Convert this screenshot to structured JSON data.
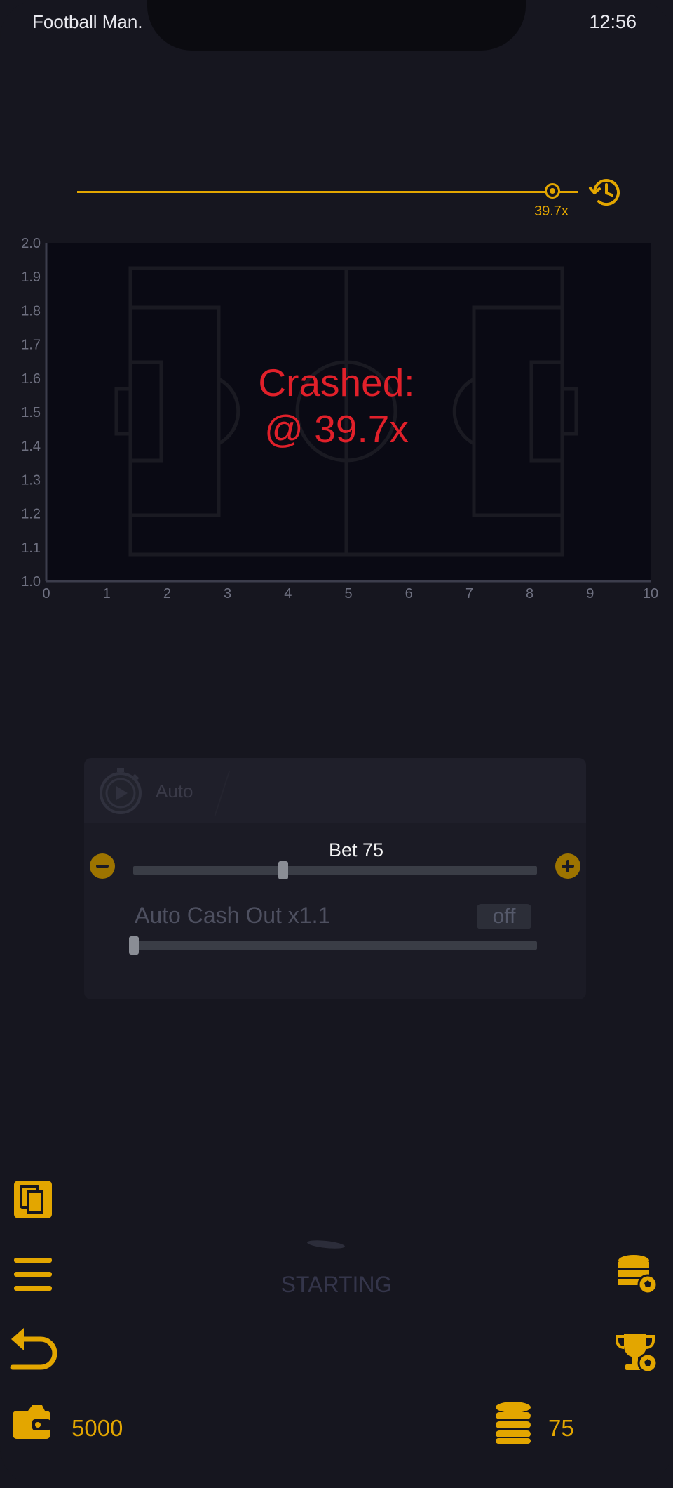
{
  "status_bar": {
    "app_name": "Football Man.",
    "time": "12:56"
  },
  "history": {
    "last_multiplier": "39.7x",
    "icon": "history-icon"
  },
  "chart_data": {
    "type": "line",
    "x_ticks": [
      "0",
      "1",
      "2",
      "3",
      "4",
      "5",
      "6",
      "7",
      "8",
      "9",
      "10"
    ],
    "y_ticks": [
      "1.0",
      "1.1",
      "1.2",
      "1.3",
      "1.4",
      "1.5",
      "1.6",
      "1.7",
      "1.8",
      "1.9",
      "2.0"
    ],
    "xlim": [
      0,
      10
    ],
    "ylim": [
      1.0,
      2.0
    ],
    "series": [],
    "background": "football-pitch",
    "annotation": {
      "line1": "Crashed:",
      "line2": "@ 39.7x"
    }
  },
  "controls": {
    "mode_label": "Auto",
    "bet_label": "Bet 75",
    "bet_fraction": 0.36,
    "auto_cash_out_label": "Auto Cash Out x1.1",
    "auto_cash_out_toggle": "off",
    "auto_cash_out_fraction": 0.0
  },
  "round_status": "STARTING",
  "footer": {
    "balance": "5000",
    "bet_total": "75"
  },
  "colors": {
    "accent": "#e3a600",
    "crash": "#e0202a",
    "background": "#16161f",
    "chart_bg": "#0a0a14"
  }
}
